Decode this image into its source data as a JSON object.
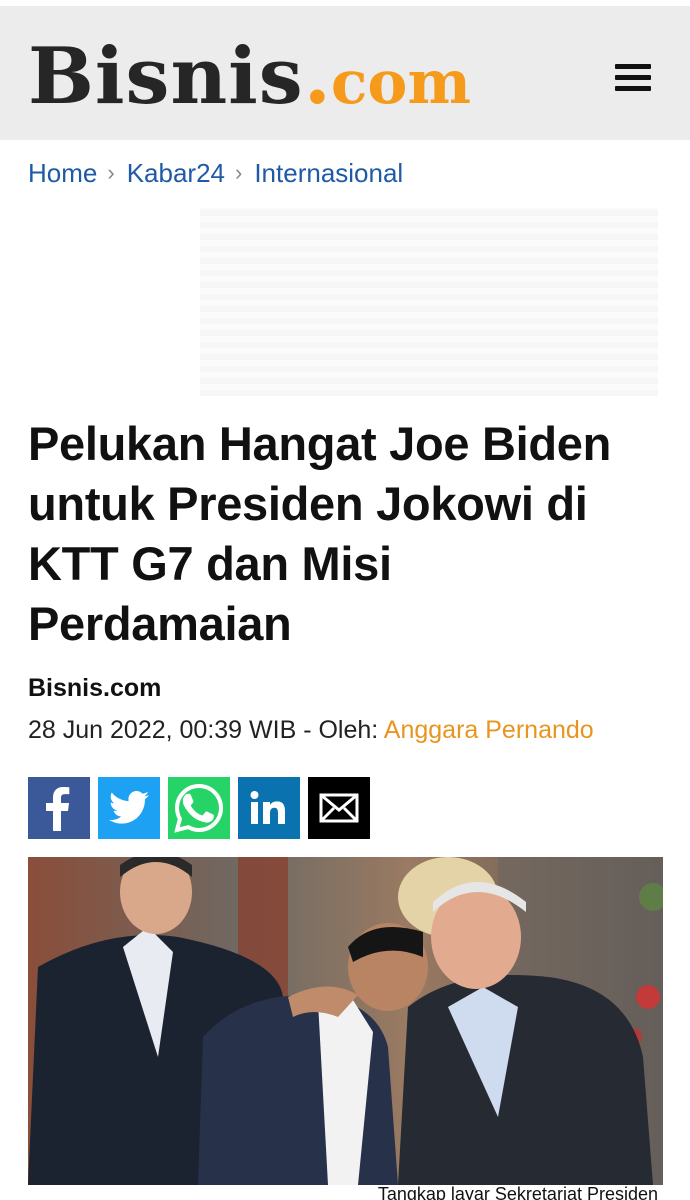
{
  "header": {
    "logo_main": "Bisnis",
    "logo_dot": ".",
    "logo_com": "com",
    "menu_icon": "hamburger-menu-icon"
  },
  "breadcrumb": [
    {
      "label": "Home"
    },
    {
      "label": "Kabar24"
    },
    {
      "label": "Internasional"
    }
  ],
  "breadcrumb_separator": "›",
  "article": {
    "title": "Pelukan Hangat Joe Biden untuk Presiden Jokowi di KTT G7 dan Misi Perdamaian",
    "source": "Bisnis.com",
    "date": "28 Jun 2022, 00:39 WIB",
    "by_label": " - Oleh: ",
    "author": "Anggara Pernando",
    "photo_caption": "Tangkap layar Sekretariat Presiden"
  },
  "share": [
    {
      "name": "facebook",
      "icon": "facebook-icon"
    },
    {
      "name": "twitter",
      "icon": "twitter-icon"
    },
    {
      "name": "whatsapp",
      "icon": "whatsapp-icon"
    },
    {
      "name": "linkedin",
      "icon": "linkedin-icon"
    },
    {
      "name": "email",
      "icon": "mail-icon"
    }
  ],
  "colors": {
    "header_bg": "#ececec",
    "accent_orange": "#f59a1b",
    "link_blue": "#1f5aa6",
    "author_orange": "#e8951f",
    "facebook": "#3b5998",
    "twitter": "#1da1f2",
    "whatsapp": "#25d366",
    "linkedin": "#0b72b0",
    "email": "#000000"
  }
}
